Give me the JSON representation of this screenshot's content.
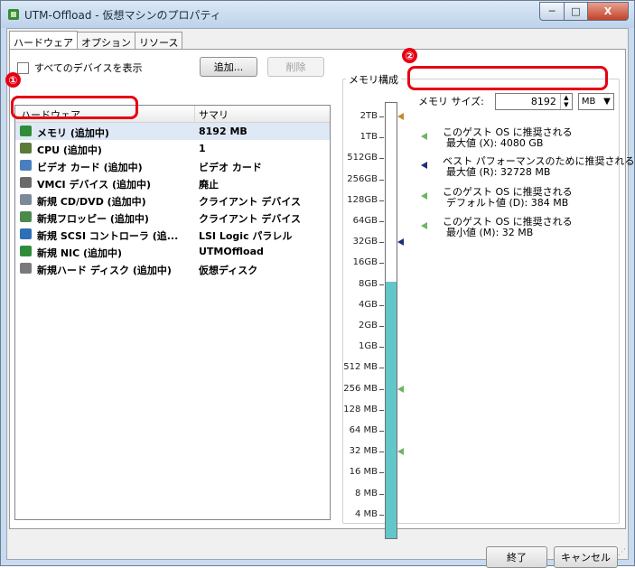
{
  "window": {
    "title": "UTM-Offload - 仮想マシンのプロパティ",
    "caption_min": "─",
    "caption_max": "□",
    "caption_close": "X"
  },
  "tabs": [
    {
      "label": "ハードウェア",
      "active": true
    },
    {
      "label": "オプション",
      "active": false
    },
    {
      "label": "リソース",
      "active": false
    }
  ],
  "hardware": {
    "show_all_label": "すべてのデバイスを表示",
    "add_label": "追加...",
    "remove_label": "削除",
    "col_hardware": "ハードウェア",
    "col_summary": "サマリ",
    "devices": [
      {
        "name": "メモリ (追加中)",
        "summary": "8192 MB",
        "icon": "memory-icon",
        "selected": true
      },
      {
        "name": "CPU (追加中)",
        "summary": "1",
        "icon": "cpu-icon",
        "selected": false
      },
      {
        "name": "ビデオ カード (追加中)",
        "summary": "ビデオ カード",
        "icon": "video-card-icon",
        "selected": false
      },
      {
        "name": "VMCI デバイス (追加中)",
        "summary": "廃止",
        "icon": "vmci-device-icon",
        "selected": false
      },
      {
        "name": "新規 CD/DVD (追加中)",
        "summary": "クライアント デバイス",
        "icon": "cd-dvd-icon",
        "selected": false
      },
      {
        "name": "新規フロッピー (追加中)",
        "summary": "クライアント デバイス",
        "icon": "floppy-icon",
        "selected": false
      },
      {
        "name": "新規 SCSI コントローラ (追...",
        "summary": "LSI Logic パラレル",
        "icon": "scsi-controller-icon",
        "selected": false
      },
      {
        "name": "新規 NIC (追加中)",
        "summary": "UTMOffload",
        "icon": "nic-icon",
        "selected": false
      },
      {
        "name": "新規ハード ディスク (追加中)",
        "summary": "仮想ディスク",
        "icon": "hard-disk-icon",
        "selected": false
      }
    ]
  },
  "memory_config": {
    "group_title": "メモリ構成",
    "size_label": "メモリ サイズ:",
    "size_value": "8192",
    "unit": "MB",
    "ticks": [
      "2TB",
      "1TB",
      "512GB",
      "256GB",
      "128GB",
      "64GB",
      "32GB",
      "16GB",
      "8GB",
      "4GB",
      "2GB",
      "1GB",
      "512 MB",
      "256 MB",
      "128 MB",
      "64 MB",
      "32 MB",
      "16 MB",
      "8 MB",
      "4 MB"
    ],
    "current_level_tick": "8GB",
    "markers": [
      {
        "tick": "2TB",
        "color": "#c58a2d"
      },
      {
        "tick": "32GB",
        "color": "#1e2f7a"
      },
      {
        "tick": "256 MB",
        "color": "#6fb465"
      },
      {
        "tick": "32 MB",
        "color": "#6fb465"
      }
    ],
    "legend": [
      {
        "line1": "このゲスト OS に推奨される",
        "line2": "最大値 (X): 4080 GB",
        "color": "#6fb465"
      },
      {
        "line1": "ベスト パフォーマンスのために推奨される",
        "line2": "最大値 (R): 32728 MB",
        "color": "#1e2f7a"
      },
      {
        "line1": "このゲスト OS に推奨される",
        "line2": "デフォルト値 (D): 384 MB",
        "color": "#6fb465"
      },
      {
        "line1": "このゲスト OS に推奨される",
        "line2": "最小値 (M): 32 MB",
        "color": "#6fb465"
      }
    ]
  },
  "callouts": {
    "one": "①",
    "two": "②",
    "color": "#e60012"
  },
  "footer": {
    "finish_label": "終了",
    "cancel_label": "キャンセル"
  }
}
